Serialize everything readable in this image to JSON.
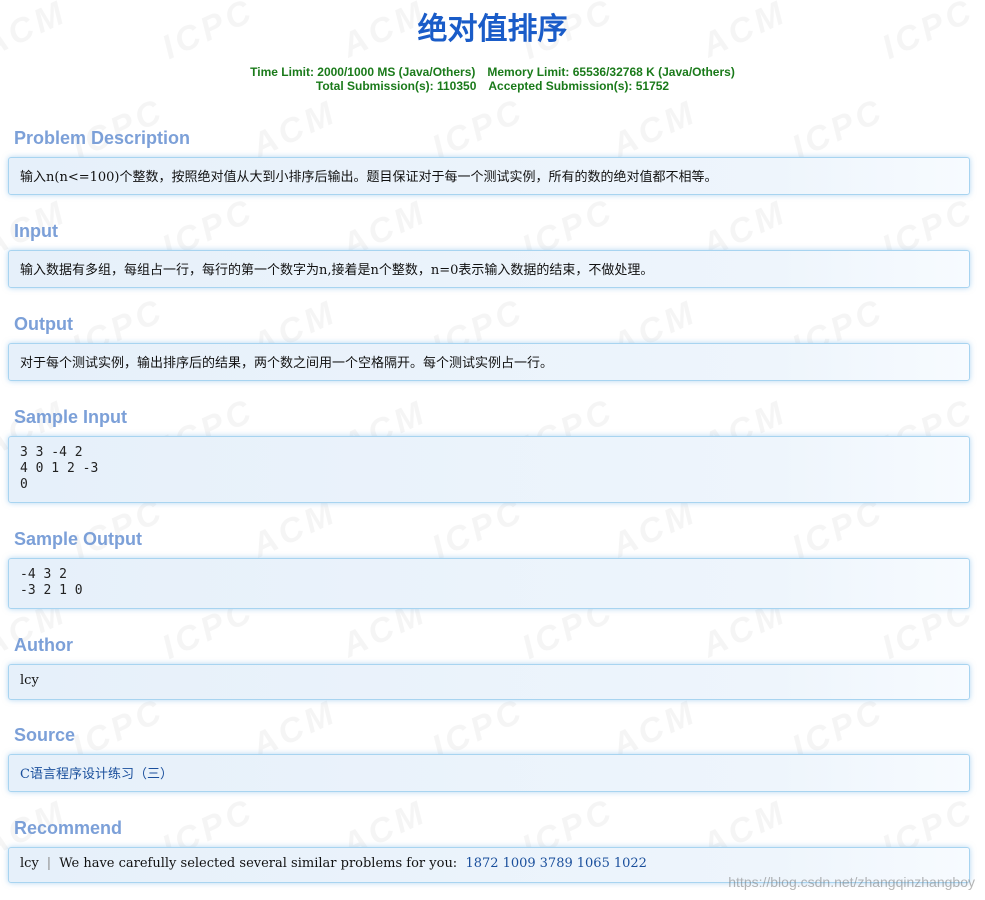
{
  "problem": {
    "title": "绝对值排序",
    "time_limit": "Time Limit: 2000/1000 MS (Java/Others)",
    "memory_limit": "Memory Limit: 65536/32768 K (Java/Others)",
    "total_submissions": "Total Submission(s): 110350",
    "accepted_submissions": "Accepted Submission(s): 51752"
  },
  "sections": {
    "description": {
      "heading": "Problem Description",
      "text": "输入n(n<=100)个整数，按照绝对值从大到小排序后输出。题目保证对于每一个测试实例，所有的数的绝对值都不相等。"
    },
    "input": {
      "heading": "Input",
      "text": "输入数据有多组，每组占一行，每行的第一个数字为n,接着是n个整数，n=0表示输入数据的结束，不做处理。"
    },
    "output": {
      "heading": "Output",
      "text": "对于每个测试实例，输出排序后的结果，两个数之间用一个空格隔开。每个测试实例占一行。"
    },
    "sample_input": {
      "heading": "Sample Input",
      "text": "3 3 -4 2\n4 0 1 2 -3\n0"
    },
    "sample_output": {
      "heading": "Sample Output",
      "text": "-4 3 2\n-3 2 1 0"
    },
    "author": {
      "heading": "Author",
      "text": "lcy"
    },
    "source": {
      "heading": "Source",
      "link_text": "C语言程序设计练习（三）"
    },
    "recommend": {
      "heading": "Recommend",
      "user": "lcy",
      "separator": "|",
      "lead": "We have carefully selected several similar problems for you:",
      "problems": [
        "1872",
        "1009",
        "3789",
        "1065",
        "1022"
      ]
    }
  },
  "watermark": {
    "tile_text_a": "ACM",
    "tile_text_b": "ICPC",
    "footer_text": "https://blog.csdn.net/zhangqinzhangboy"
  },
  "colors": {
    "title": "#1a5cc8",
    "limits": "#1a7a1a",
    "section_heading": "#7ca0d8",
    "link": "#1a4f9c",
    "panel_border": "#a8d4f0"
  }
}
